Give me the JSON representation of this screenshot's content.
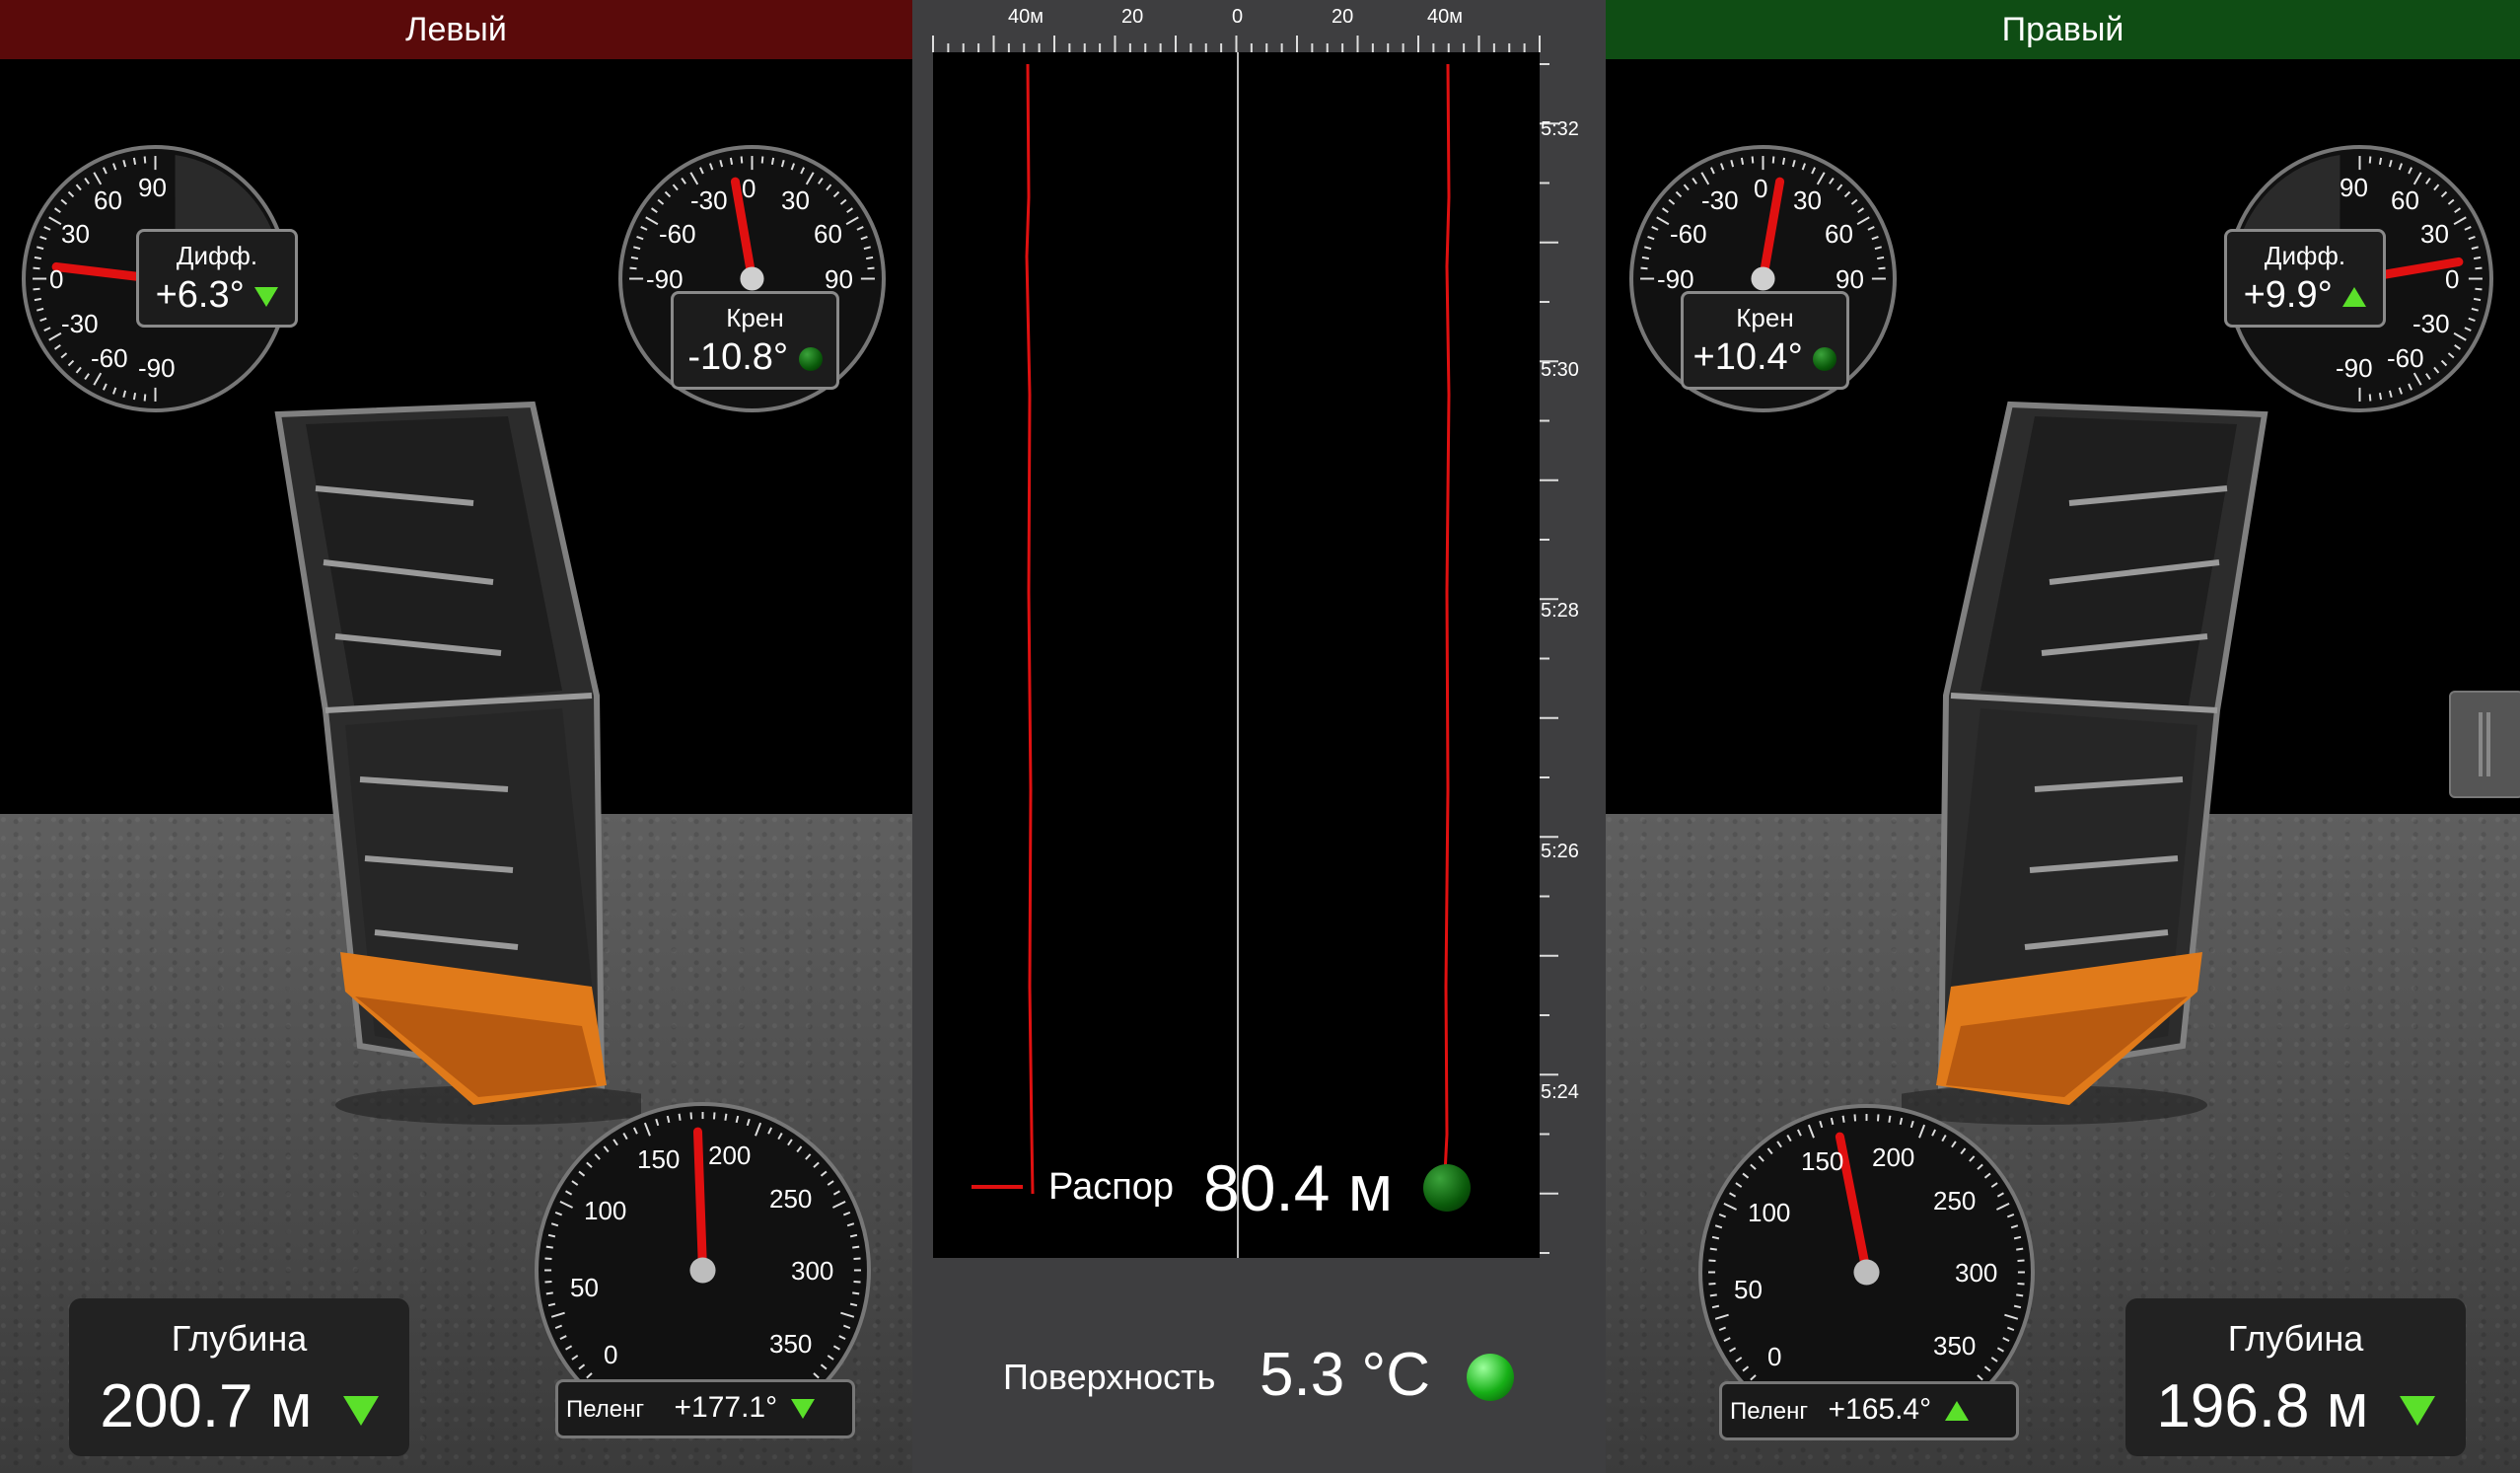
{
  "left": {
    "header": "Левый",
    "header_color": "#5a0a0a",
    "diff_gauge": {
      "ticks": [
        "90",
        "60",
        "30",
        "0",
        "-30",
        "-60",
        "-90"
      ],
      "label": "Дифф.",
      "value": "+6.3°",
      "icon": "triangle-down-icon"
    },
    "roll_gauge": {
      "ticks": [
        "-30",
        "0",
        "30",
        "-60",
        "60",
        "-90",
        "90"
      ],
      "label": "Крен",
      "value": "-10.8°",
      "status_icon": "green-led-icon"
    },
    "depth": {
      "label": "Глубина",
      "value": "200.7 м",
      "icon": "triangle-down-icon"
    },
    "heading_gauge": {
      "ticks": [
        "0",
        "50",
        "100",
        "150",
        "200",
        "250",
        "300",
        "350"
      ],
      "label": "Пеленг",
      "value": "+177.1°",
      "icon": "triangle-down-icon"
    }
  },
  "right": {
    "header": "Правый",
    "header_color": "#0f4d14",
    "diff_gauge": {
      "ticks": [
        "90",
        "60",
        "30",
        "0",
        "-30",
        "-60",
        "-90"
      ],
      "label": "Дифф.",
      "value": "+9.9°",
      "icon": "triangle-up-icon"
    },
    "roll_gauge": {
      "ticks": [
        "-30",
        "0",
        "30",
        "-60",
        "60",
        "-90",
        "90"
      ],
      "label": "Крен",
      "value": "+10.4°",
      "status_icon": "green-led-icon"
    },
    "depth": {
      "label": "Глубина",
      "value": "196.8 м",
      "icon": "triangle-down-icon"
    },
    "heading_gauge": {
      "ticks": [
        "0",
        "50",
        "100",
        "150",
        "200",
        "250",
        "300",
        "350"
      ],
      "label": "Пеленг",
      "value": "+165.4°",
      "icon": "triangle-up-icon"
    }
  },
  "center": {
    "scale_labels": [
      "40м",
      "20",
      "0",
      "20",
      "40м"
    ],
    "time_labels": [
      "5:32",
      "5:30",
      "5:28",
      "5:26",
      "5:24"
    ],
    "legend_label": "Распор",
    "spread_value": "80.4 м",
    "surface_label": "Поверхность",
    "surface_value": "5.3 °C",
    "trace_color": "#e01010"
  },
  "colors": {
    "accent_green": "#5be02a",
    "needle_red": "#e01010",
    "door_orange": "#e07a1a"
  }
}
